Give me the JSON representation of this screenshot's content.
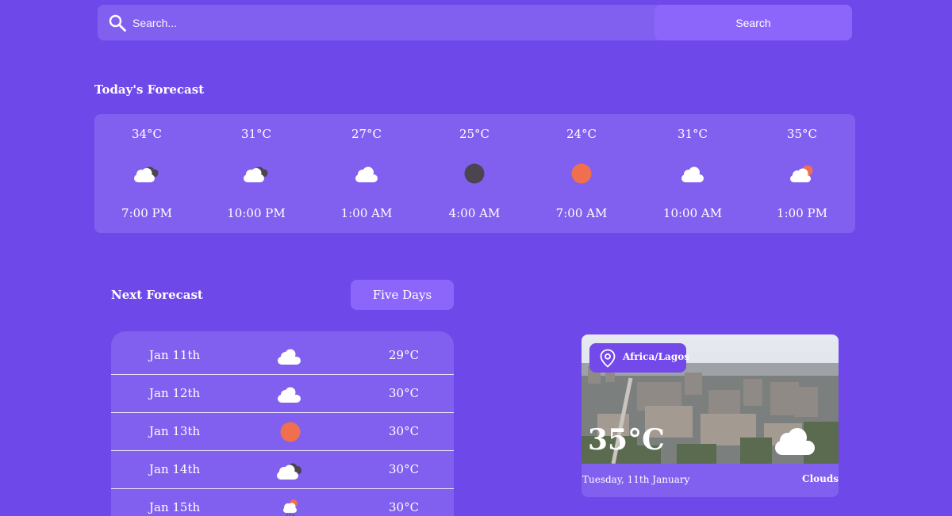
{
  "search": {
    "placeholder": "Search...",
    "button_label": "Search"
  },
  "today": {
    "title": "Today's Forecast",
    "hours": [
      {
        "temp": "34°C",
        "icon": "dark-cloud-icon",
        "time": "7:00 PM"
      },
      {
        "temp": "31°C",
        "icon": "dark-cloud-icon",
        "time": "10:00 PM"
      },
      {
        "temp": "27°C",
        "icon": "cloud-icon",
        "time": "1:00 AM"
      },
      {
        "temp": "25°C",
        "icon": "moon-icon",
        "time": "4:00 AM"
      },
      {
        "temp": "24°C",
        "icon": "sun-icon",
        "time": "7:00 AM"
      },
      {
        "temp": "31°C",
        "icon": "cloud-icon",
        "time": "10:00 AM"
      },
      {
        "temp": "35°C",
        "icon": "sun-cloud-icon",
        "time": "1:00 PM"
      }
    ]
  },
  "next": {
    "title": "Next Forecast",
    "range_button": "Five Days",
    "days": [
      {
        "date": "Jan 11th",
        "icon": "cloud-icon",
        "temp": "29°C"
      },
      {
        "date": "Jan 12th",
        "icon": "cloud-icon",
        "temp": "30°C"
      },
      {
        "date": "Jan 13th",
        "icon": "sun-icon",
        "temp": "30°C"
      },
      {
        "date": "Jan 14th",
        "icon": "dark-cloud-icon",
        "temp": "30°C"
      },
      {
        "date": "Jan 15th",
        "icon": "sun-rain-icon",
        "temp": "30°C"
      }
    ]
  },
  "current": {
    "location": "Africa/Lagos",
    "temp": "35°C",
    "date": "Tuesday, 11th January",
    "condition": "Clouds",
    "icon": "cloud-icon"
  },
  "colors": {
    "background": "#6f48ea",
    "card": "#8160ef",
    "button": "#8c66fb",
    "sun": "#ef6f4f",
    "moon": "#4b4551",
    "dark_cloud": "#4b4551"
  }
}
